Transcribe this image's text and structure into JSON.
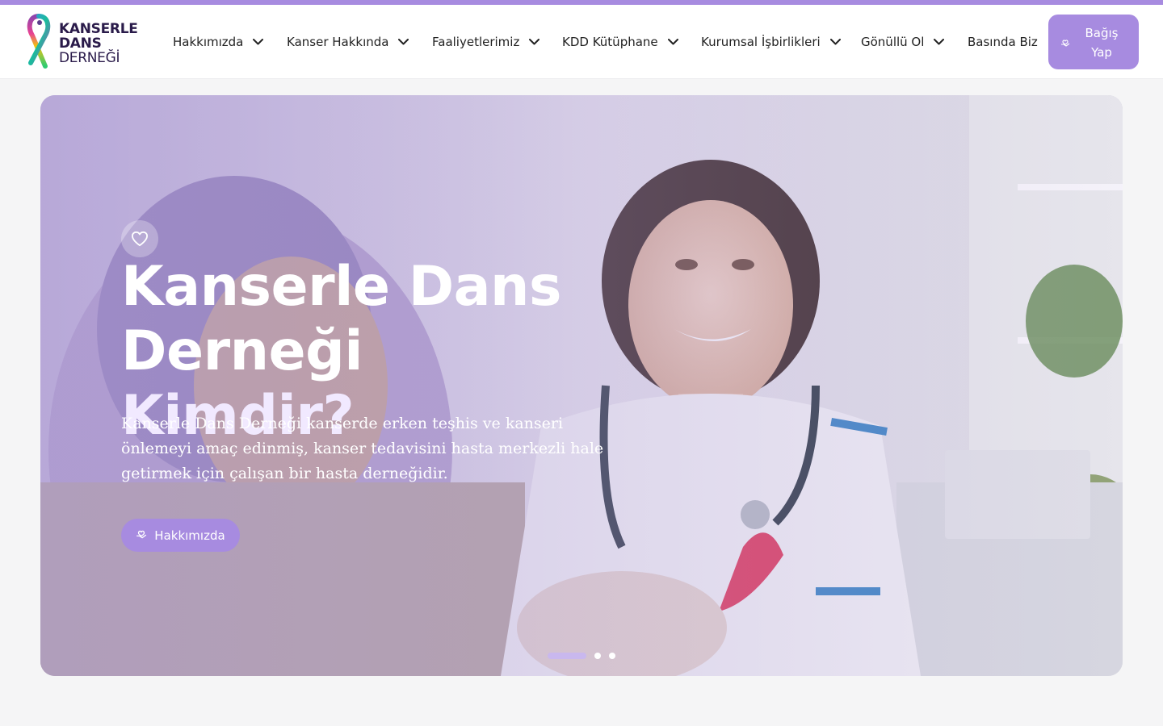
{
  "brand": {
    "logo_lines": [
      "KANSERLE",
      "DANS",
      "DERNEĞİ"
    ],
    "accent_color": "#a78be0",
    "icon": "rainbow-ribbon-logo"
  },
  "nav": {
    "items": [
      {
        "label": "Hakkımızda",
        "has_dropdown": true
      },
      {
        "label": "Kanser Hakkında",
        "has_dropdown": true
      },
      {
        "label": "Faaliyetlerimiz",
        "has_dropdown": true
      },
      {
        "label": "KDD Kütüphane",
        "has_dropdown": true
      },
      {
        "label": "Kurumsal İşbirlikleri",
        "has_dropdown": true
      },
      {
        "label": "Gönüllü Ol",
        "has_dropdown": true
      },
      {
        "label": "Basında Biz",
        "has_dropdown": false
      }
    ],
    "donate": {
      "label": "Bağış Yap",
      "icon": "hand-heart-icon"
    }
  },
  "hero": {
    "icon": "heart-icon",
    "title_line1": "Kanserle Dans Derneği",
    "title_line2": "Kimdir?",
    "description": "Kanserle Dans Derneği kanserde erken teşhis ve kanseri önlemeyi amaç edinmiş, kanser tedavisini hasta merkezli hale getirmek için çalışan bir hasta derneğidir.",
    "button": {
      "label": "Hakkımızda",
      "icon": "hand-heart-icon"
    },
    "slides": {
      "count": 3,
      "active_index": 0
    }
  }
}
